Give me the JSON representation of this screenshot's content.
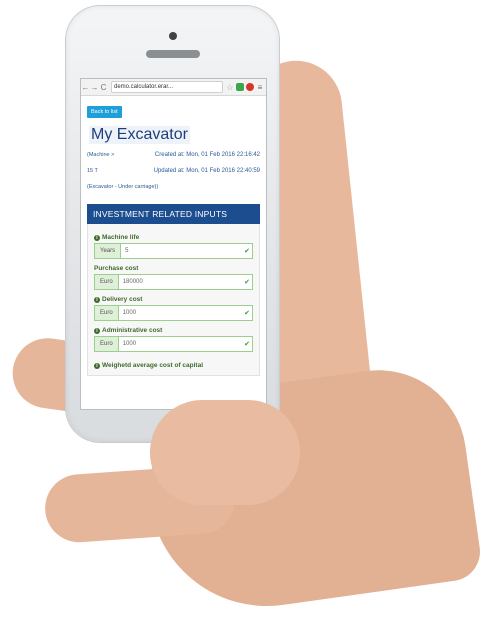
{
  "browser": {
    "url": "demo.calculator.erar...",
    "back_glyph": "←",
    "forward_glyph": "→",
    "reload_glyph": "C",
    "star_glyph": "☆",
    "menu_glyph": "≡"
  },
  "page": {
    "back_label": "Back to list",
    "title": "My Excavator",
    "machine_prefix": "(Machine >",
    "created": "Created at: Mon, 01 Feb 2016 22:16:42",
    "weight": "15 T",
    "updated": "Updated at: Mon, 01 Feb 2016 22:40:59",
    "tag": "(Excavator - Under carriage))"
  },
  "section": {
    "title": "INVESTMENT RELATED INPUTS",
    "fields": [
      {
        "label": "Machine life",
        "unit": "Years",
        "value": "5"
      },
      {
        "label": "Purchase cost",
        "unit": "Euro",
        "value": "180000"
      },
      {
        "label": "Delivery cost",
        "unit": "Euro",
        "value": "1000"
      },
      {
        "label": "Administrative cost",
        "unit": "Euro",
        "value": "1000"
      },
      {
        "label": "Weighetd average cost of capital"
      }
    ]
  },
  "colors": {
    "header_blue": "#1c4e8f",
    "button_blue": "#1d9fd8",
    "valid_green": "#3a9d3a",
    "label_green": "#3d6b2a"
  }
}
